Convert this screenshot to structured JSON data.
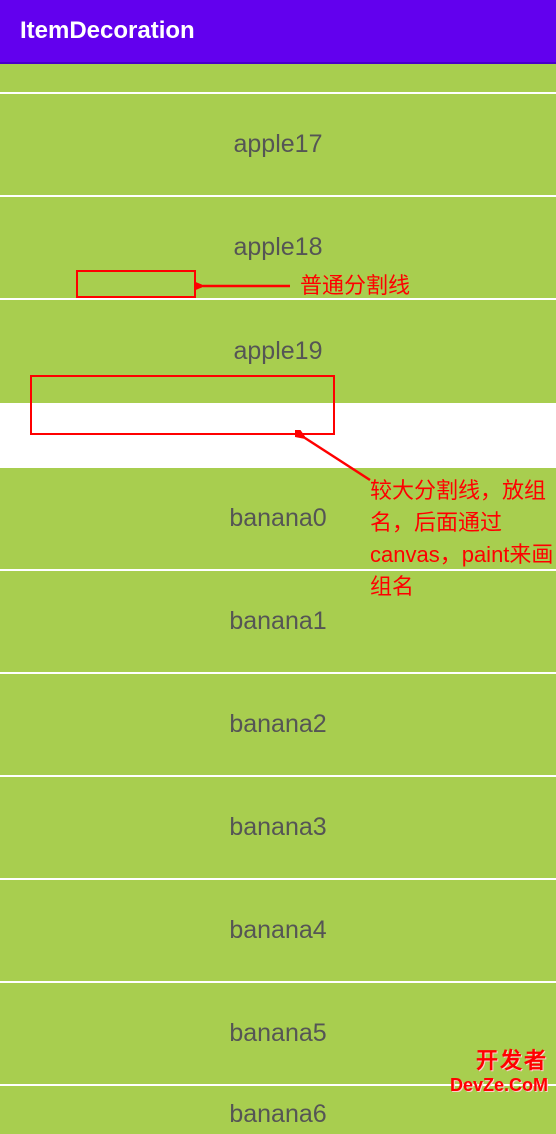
{
  "appBar": {
    "title": "ItemDecoration"
  },
  "items": {
    "partial1": "",
    "apple17": "apple17",
    "apple18": "apple18",
    "apple19": "apple19",
    "banana0": "banana0",
    "banana1": "banana1",
    "banana2": "banana2",
    "banana3": "banana3",
    "banana4": "banana4",
    "banana5": "banana5",
    "banana6": "banana6"
  },
  "annotations": {
    "normalDivider": "普通分割线",
    "largeDivider": "较大分割线，放组名，后面通过canvas，paint来画组名"
  },
  "watermark": {
    "line1": "开发者",
    "line2": "DevZe.CoM"
  }
}
